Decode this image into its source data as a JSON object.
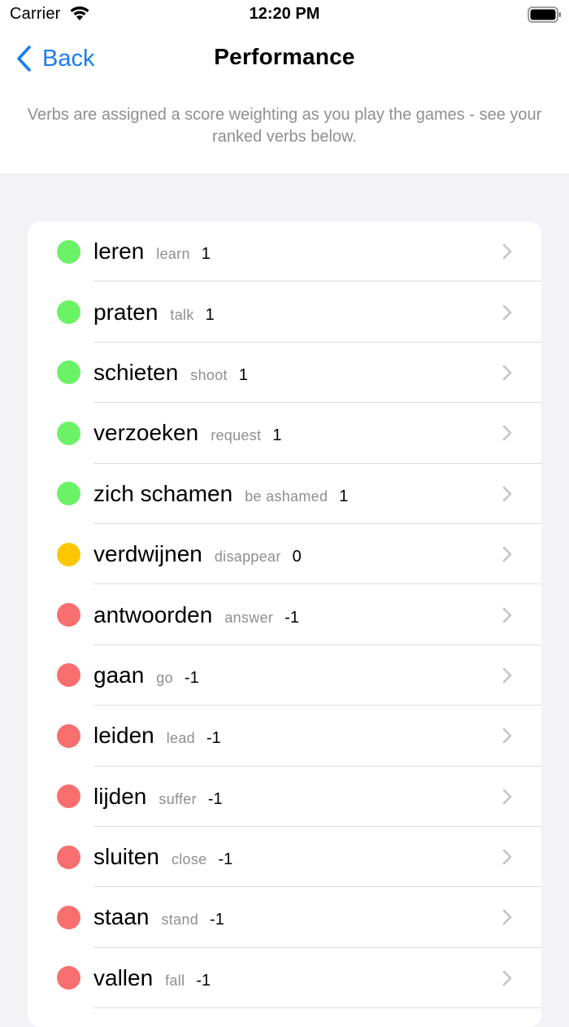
{
  "status_bar": {
    "carrier": "Carrier",
    "time": "12:20 PM"
  },
  "nav": {
    "back_label": "Back",
    "title": "Performance"
  },
  "description": "Verbs are assigned a score weighting as you play the games - see your ranked verbs below.",
  "colors": {
    "accent": "#1a7cf4",
    "positive": "#6bf266",
    "neutral": "#fdc700",
    "negative": "#f96e6e"
  },
  "verbs": [
    {
      "verb": "leren",
      "translation": "learn",
      "score": "1",
      "status": "positive"
    },
    {
      "verb": "praten",
      "translation": "talk",
      "score": "1",
      "status": "positive"
    },
    {
      "verb": "schieten",
      "translation": "shoot",
      "score": "1",
      "status": "positive"
    },
    {
      "verb": "verzoeken",
      "translation": "request",
      "score": "1",
      "status": "positive"
    },
    {
      "verb": "zich schamen",
      "translation": "be ashamed",
      "score": "1",
      "status": "positive"
    },
    {
      "verb": "verdwijnen",
      "translation": "disappear",
      "score": "0",
      "status": "neutral"
    },
    {
      "verb": "antwoorden",
      "translation": "answer",
      "score": "-1",
      "status": "negative"
    },
    {
      "verb": "gaan",
      "translation": "go",
      "score": "-1",
      "status": "negative"
    },
    {
      "verb": "leiden",
      "translation": "lead",
      "score": "-1",
      "status": "negative"
    },
    {
      "verb": "lijden",
      "translation": "suffer",
      "score": "-1",
      "status": "negative"
    },
    {
      "verb": "sluiten",
      "translation": "close",
      "score": "-1",
      "status": "negative"
    },
    {
      "verb": "staan",
      "translation": "stand",
      "score": "-1",
      "status": "negative"
    },
    {
      "verb": "vallen",
      "translation": "fall",
      "score": "-1",
      "status": "negative"
    }
  ]
}
